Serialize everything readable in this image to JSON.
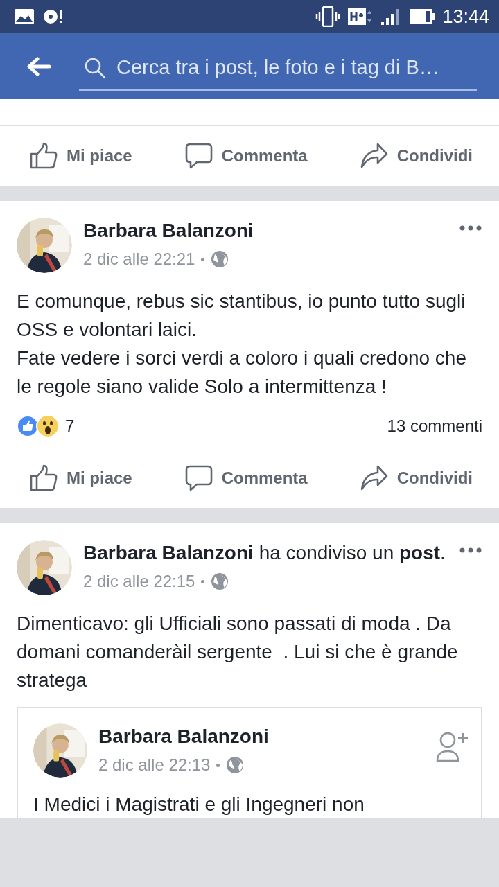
{
  "status_bar": {
    "time": "13:44"
  },
  "search": {
    "placeholder": "Cerca tra i post, le foto e i tag di B…"
  },
  "top_actions": [
    "Mi piace",
    "Commenta",
    "Condividi"
  ],
  "posts": [
    {
      "header": "**Barbara Balanzoni**",
      "time": "2 dic alle 22:21",
      "paragraphs": [
        "E comunque, rebus sic stantibus, io punto tutto sugli OSS e volontari laici.",
        "Fate vedere i sorci verdi a coloro i quali credono che le regole siano valide Solo a intermittenza !"
      ],
      "reactions_count": "7",
      "comments": "13 commenti",
      "actions": [
        "Mi piace",
        "Commenta",
        "Condividi"
      ]
    },
    {
      "header": "**Barbara Balanzoni** ha condiviso un **post**.",
      "time": "2 dic alle 22:15",
      "paragraphs": [
        "Dimenticavo: gli Ufficiali sono passati di moda . Da domani comanderàil sergente  . Lui si che è grande stratega"
      ],
      "shared": {
        "author": "Barbara Balanzoni",
        "time": "2 dic alle 22:13",
        "text": "I Medici i Magistrati e gli Ingegneri non"
      }
    }
  ]
}
